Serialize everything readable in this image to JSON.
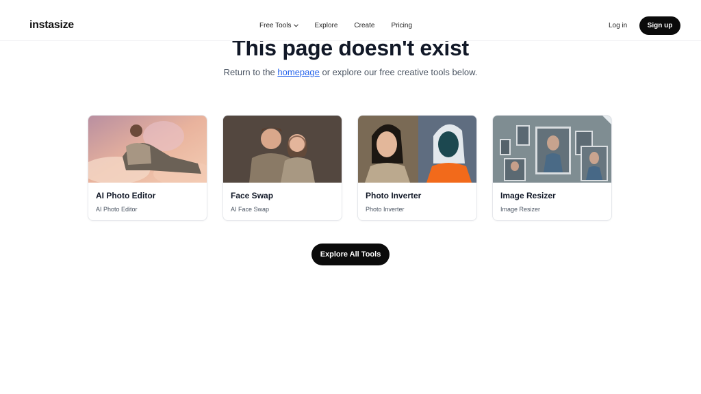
{
  "header": {
    "logo": "instasize",
    "nav": [
      {
        "label": "Free Tools",
        "has_dropdown": true
      },
      {
        "label": "Explore"
      },
      {
        "label": "Create"
      },
      {
        "label": "Pricing"
      }
    ],
    "login_label": "Log in",
    "signup_label": "Sign up"
  },
  "main": {
    "title": "This page doesn't exist",
    "subtitle_before": "Return to the ",
    "subtitle_link": "homepage",
    "subtitle_after": " or explore our free creative tools below.",
    "cards": [
      {
        "title": "AI Photo Editor",
        "subtitle": "AI Photo Editor"
      },
      {
        "title": "Face Swap",
        "subtitle": "AI Face Swap"
      },
      {
        "title": "Photo Inverter",
        "subtitle": "Photo Inverter"
      },
      {
        "title": "Image Resizer",
        "subtitle": "Image Resizer"
      }
    ],
    "explore_all_label": "Explore All Tools"
  },
  "colors": {
    "primary_button": "#0b0b0b",
    "link": "#2563eb",
    "heading": "#111827",
    "muted_text": "#4b5563"
  }
}
